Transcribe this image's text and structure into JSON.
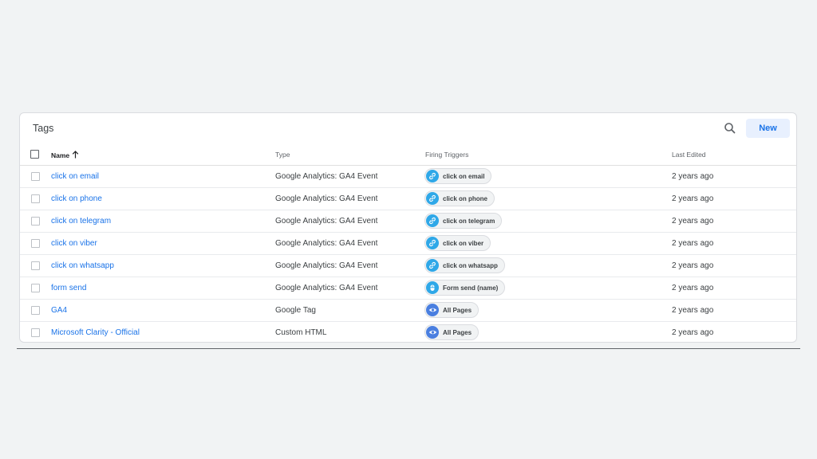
{
  "panel": {
    "title": "Tags",
    "new_label": "New"
  },
  "columns": {
    "name": "Name",
    "type": "Type",
    "triggers": "Firing Triggers",
    "last_edited": "Last Edited"
  },
  "rows": [
    {
      "name": "click on email",
      "type": "Google Analytics: GA4 Event",
      "trigger": "click on email",
      "trigger_icon": "link-icon",
      "last_edited": "2 years ago"
    },
    {
      "name": "click on phone",
      "type": "Google Analytics: GA4 Event",
      "trigger": "click on phone",
      "trigger_icon": "link-icon",
      "last_edited": "2 years ago"
    },
    {
      "name": "click on telegram",
      "type": "Google Analytics: GA4 Event",
      "trigger": "click on telegram",
      "trigger_icon": "link-icon",
      "last_edited": "2 years ago"
    },
    {
      "name": "click on viber",
      "type": "Google Analytics: GA4 Event",
      "trigger": "click on viber",
      "trigger_icon": "link-icon",
      "last_edited": "2 years ago"
    },
    {
      "name": "click on whatsapp",
      "type": "Google Analytics: GA4 Event",
      "trigger": "click on whatsapp",
      "trigger_icon": "link-icon",
      "last_edited": "2 years ago"
    },
    {
      "name": "form send",
      "type": "Google Analytics: GA4 Event",
      "trigger": "Form send (name)",
      "trigger_icon": "form-icon",
      "last_edited": "2 years ago"
    },
    {
      "name": "GA4",
      "type": "Google Tag",
      "trigger": "All Pages",
      "trigger_icon": "eye-icon",
      "last_edited": "2 years ago"
    },
    {
      "name": "Microsoft Clarity - Official",
      "type": "Custom HTML",
      "trigger": "All Pages",
      "trigger_icon": "eye-icon",
      "last_edited": "2 years ago"
    }
  ],
  "colors": {
    "accent": "#1a73e8",
    "background": "#f1f3f4",
    "link_trigger": "#2fa8e8",
    "pageview_trigger": "#4a7fe0"
  }
}
